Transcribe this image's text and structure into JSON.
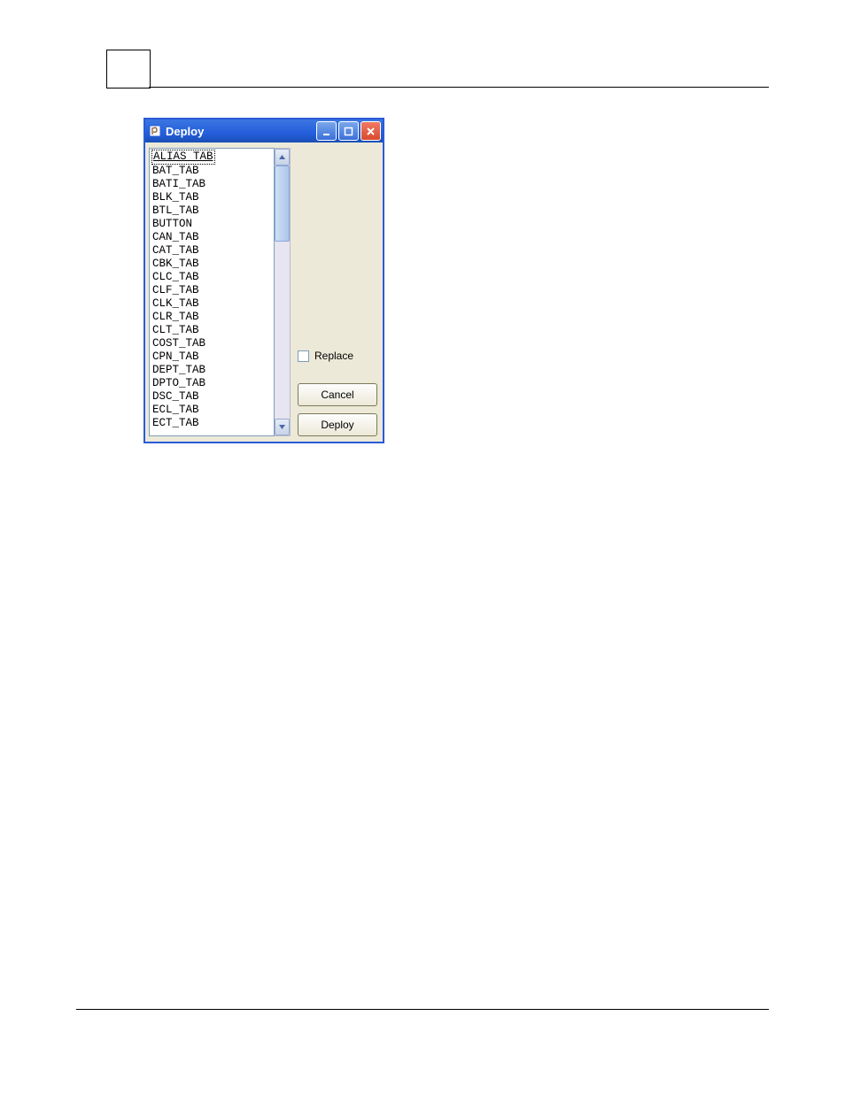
{
  "dialog": {
    "title": "Deploy",
    "list_items": [
      "ALIAS_TAB",
      "BAT_TAB",
      "BATI_TAB",
      "BLK_TAB",
      "BTL_TAB",
      "BUTTON",
      "CAN_TAB",
      "CAT_TAB",
      "CBK_TAB",
      "CLC_TAB",
      "CLF_TAB",
      "CLK_TAB",
      "CLR_TAB",
      "CLT_TAB",
      "COST_TAB",
      "CPN_TAB",
      "DEPT_TAB",
      "DPTO_TAB",
      "DSC_TAB",
      "ECL_TAB",
      "ECT_TAB"
    ],
    "selected_index": 0,
    "replace_label": "Replace",
    "replace_checked": false,
    "cancel_label": "Cancel",
    "deploy_label": "Deploy"
  }
}
